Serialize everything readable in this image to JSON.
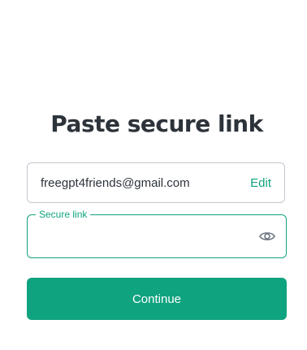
{
  "title": "Paste secure link",
  "email": {
    "value": "freegpt4friends@gmail.com",
    "edit_label": "Edit"
  },
  "secure_link": {
    "label": "Secure link",
    "value": "",
    "toggle_icon": "eye-icon"
  },
  "continue_label": "Continue",
  "colors": {
    "accent": "#10a37f",
    "text": "#2d333a",
    "border": "#c2c8d0"
  }
}
